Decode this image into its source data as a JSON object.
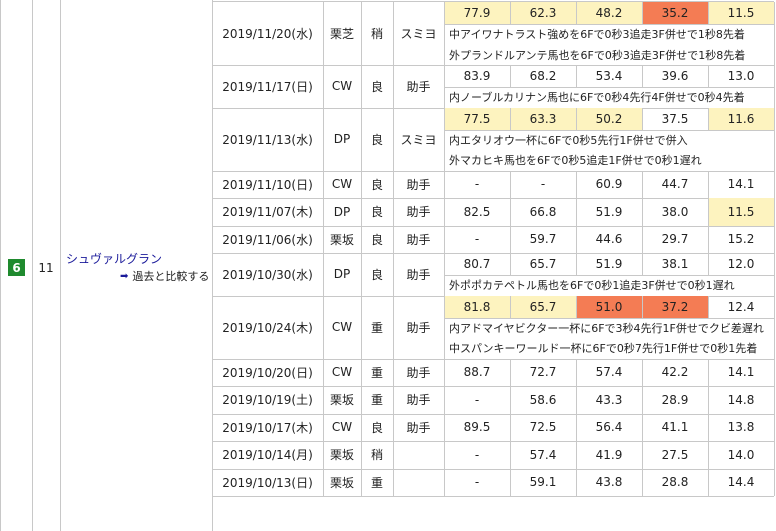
{
  "entry": {
    "waku": "6",
    "umaban": "11",
    "horse_name": "シュヴァルグラン",
    "compare_label": "過去と比較する",
    "compare_icon": "arrow-right-icon",
    "waku_color": "#1f8a2e"
  },
  "colors": {
    "highlight_yellow": "#fdf3bf",
    "highlight_orange": "#f47c54"
  },
  "workouts": [
    {
      "date": "2019/11/20(水)",
      "course": "栗芝",
      "cond": "稍",
      "rider": "スミヨ",
      "times": [
        "77.9",
        "62.3",
        "48.2",
        "35.2",
        "11.5"
      ],
      "hl": [
        "y",
        "y",
        "y",
        "o",
        "y"
      ],
      "notes": [
        "中アイワナトラスト強めを6Fで0秒3追走3F併せで1秒8先着",
        "外プランドルアンテ馬也を6Fで0秒3追走3F併せで1秒8先着"
      ]
    },
    {
      "date": "2019/11/17(日)",
      "course": "CW",
      "cond": "良",
      "rider": "助手",
      "times": [
        "83.9",
        "68.2",
        "53.4",
        "39.6",
        "13.0"
      ],
      "hl": [
        "",
        "",
        "",
        "",
        ""
      ],
      "notes": [
        "内ノーブルカリナン馬也に6Fで0秒4先行4F併せで0秒4先着"
      ]
    },
    {
      "date": "2019/11/13(水)",
      "course": "DP",
      "cond": "良",
      "rider": "スミヨ",
      "times": [
        "77.5",
        "63.3",
        "50.2",
        "37.5",
        "11.6"
      ],
      "hl": [
        "y",
        "y",
        "y",
        "",
        "y"
      ],
      "notes": [
        "内エタリオウ一杯に6Fで0秒5先行1F併せで併入",
        "外マカヒキ馬也を6Fで0秒5追走1F併せで0秒1遅れ"
      ]
    },
    {
      "date": "2019/11/10(日)",
      "course": "CW",
      "cond": "良",
      "rider": "助手",
      "times": [
        "-",
        "-",
        "60.9",
        "44.7",
        "14.1"
      ],
      "hl": [
        "",
        "",
        "",
        "",
        ""
      ],
      "notes": []
    },
    {
      "date": "2019/11/07(木)",
      "course": "DP",
      "cond": "良",
      "rider": "助手",
      "times": [
        "82.5",
        "66.8",
        "51.9",
        "38.0",
        "11.5"
      ],
      "hl": [
        "",
        "",
        "",
        "",
        "y"
      ],
      "notes": []
    },
    {
      "date": "2019/11/06(水)",
      "course": "栗坂",
      "cond": "良",
      "rider": "助手",
      "times": [
        "-",
        "59.7",
        "44.6",
        "29.7",
        "15.2"
      ],
      "hl": [
        "",
        "",
        "",
        "",
        ""
      ],
      "notes": []
    },
    {
      "date": "2019/10/30(水)",
      "course": "DP",
      "cond": "良",
      "rider": "助手",
      "times": [
        "80.7",
        "65.7",
        "51.9",
        "38.1",
        "12.0"
      ],
      "hl": [
        "",
        "",
        "",
        "",
        ""
      ],
      "notes": [
        "外ポポカテペトル馬也を6Fで0秒1追走3F併せで0秒1遅れ"
      ]
    },
    {
      "date": "2019/10/24(木)",
      "course": "CW",
      "cond": "重",
      "rider": "助手",
      "times": [
        "81.8",
        "65.7",
        "51.0",
        "37.2",
        "12.4"
      ],
      "hl": [
        "y",
        "y",
        "o",
        "o",
        ""
      ],
      "notes": [
        "内アドマイヤビクター一杯に6Fで3秒4先行1F併せでクビ差遅れ",
        "中スパンキーワールド一杯に6Fで0秒7先行1F併せで0秒1先着"
      ]
    },
    {
      "date": "2019/10/20(日)",
      "course": "CW",
      "cond": "重",
      "rider": "助手",
      "times": [
        "88.7",
        "72.7",
        "57.4",
        "42.2",
        "14.1"
      ],
      "hl": [
        "",
        "",
        "",
        "",
        ""
      ],
      "notes": []
    },
    {
      "date": "2019/10/19(土)",
      "course": "栗坂",
      "cond": "重",
      "rider": "助手",
      "times": [
        "-",
        "58.6",
        "43.3",
        "28.9",
        "14.8"
      ],
      "hl": [
        "",
        "",
        "",
        "",
        ""
      ],
      "notes": []
    },
    {
      "date": "2019/10/17(木)",
      "course": "CW",
      "cond": "良",
      "rider": "助手",
      "times": [
        "89.5",
        "72.5",
        "56.4",
        "41.1",
        "13.8"
      ],
      "hl": [
        "",
        "",
        "",
        "",
        ""
      ],
      "notes": []
    },
    {
      "date": "2019/10/14(月)",
      "course": "栗坂",
      "cond": "稍",
      "rider": "",
      "times": [
        "-",
        "57.4",
        "41.9",
        "27.5",
        "14.0"
      ],
      "hl": [
        "",
        "",
        "",
        "",
        ""
      ],
      "notes": []
    },
    {
      "date": "2019/10/13(日)",
      "course": "栗坂",
      "cond": "重",
      "rider": "",
      "times": [
        "-",
        "59.1",
        "43.8",
        "28.8",
        "14.4"
      ],
      "hl": [
        "",
        "",
        "",
        "",
        ""
      ],
      "notes": []
    }
  ]
}
